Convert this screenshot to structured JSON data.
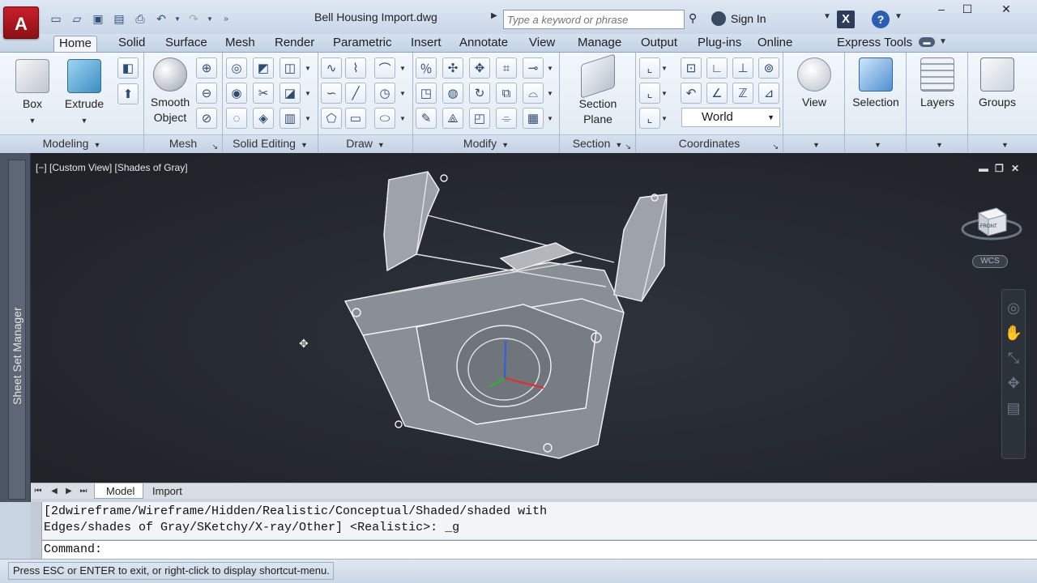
{
  "app": {
    "logo_letter": "A",
    "document_title": "Bell Housing Import.dwg"
  },
  "search": {
    "placeholder": "Type a keyword or phrase"
  },
  "account": {
    "sign_in_label": "Sign In",
    "exchange_label": "X",
    "help_label": "?"
  },
  "window_controls": {
    "minimize": "–",
    "maximize": "☐",
    "close": "✕"
  },
  "ribbon_tabs": [
    "Home",
    "Solid",
    "Surface",
    "Mesh",
    "Render",
    "Parametric",
    "Insert",
    "Annotate",
    "View",
    "Manage",
    "Output",
    "Plug-ins",
    "Online",
    "Express Tools"
  ],
  "active_tab": "Home",
  "panels": {
    "modeling": {
      "title": "Modeling",
      "box_label": "Box",
      "extrude_label": "Extrude"
    },
    "mesh": {
      "title": "Mesh",
      "smooth_line1": "Smooth",
      "smooth_line2": "Object"
    },
    "solid_editing": {
      "title": "Solid Editing"
    },
    "draw": {
      "title": "Draw"
    },
    "modify": {
      "title": "Modify"
    },
    "section": {
      "title": "Section",
      "plane_line1": "Section",
      "plane_line2": "Plane"
    },
    "coordinates": {
      "title": "Coordinates",
      "ucs_value": "World"
    },
    "view": {
      "label": "View"
    },
    "selection": {
      "label": "Selection"
    },
    "layers": {
      "label": "Layers"
    },
    "groups": {
      "label": "Groups"
    }
  },
  "viewport": {
    "view_label": "[−] [Custom View] [Shades of Gray]",
    "viewcube_face": "FRONT",
    "wcs_label": "WCS",
    "minimize": "▬",
    "maximize": "❐",
    "close": "✕"
  },
  "palette": {
    "label": "Sheet Set Manager"
  },
  "layout_tabs": [
    "Model",
    "Import"
  ],
  "active_layout": "Model",
  "command": {
    "history_line1": "[2dwireframe/Wireframe/Hidden/Realistic/Conceptual/Shaded/shaded with",
    "history_line2": "Edges/shades of Gray/SKetchy/X-ray/Other] <Realistic>: _g",
    "prompt": "Command:"
  },
  "status": {
    "message": "Press ESC or ENTER to exit, or right-click to display shortcut-menu."
  },
  "colors": {
    "viewport_bg": "#262a30",
    "accent": "#c8202a",
    "axis_x": "#e03030",
    "axis_y": "#30b030",
    "axis_z": "#3060e0"
  }
}
